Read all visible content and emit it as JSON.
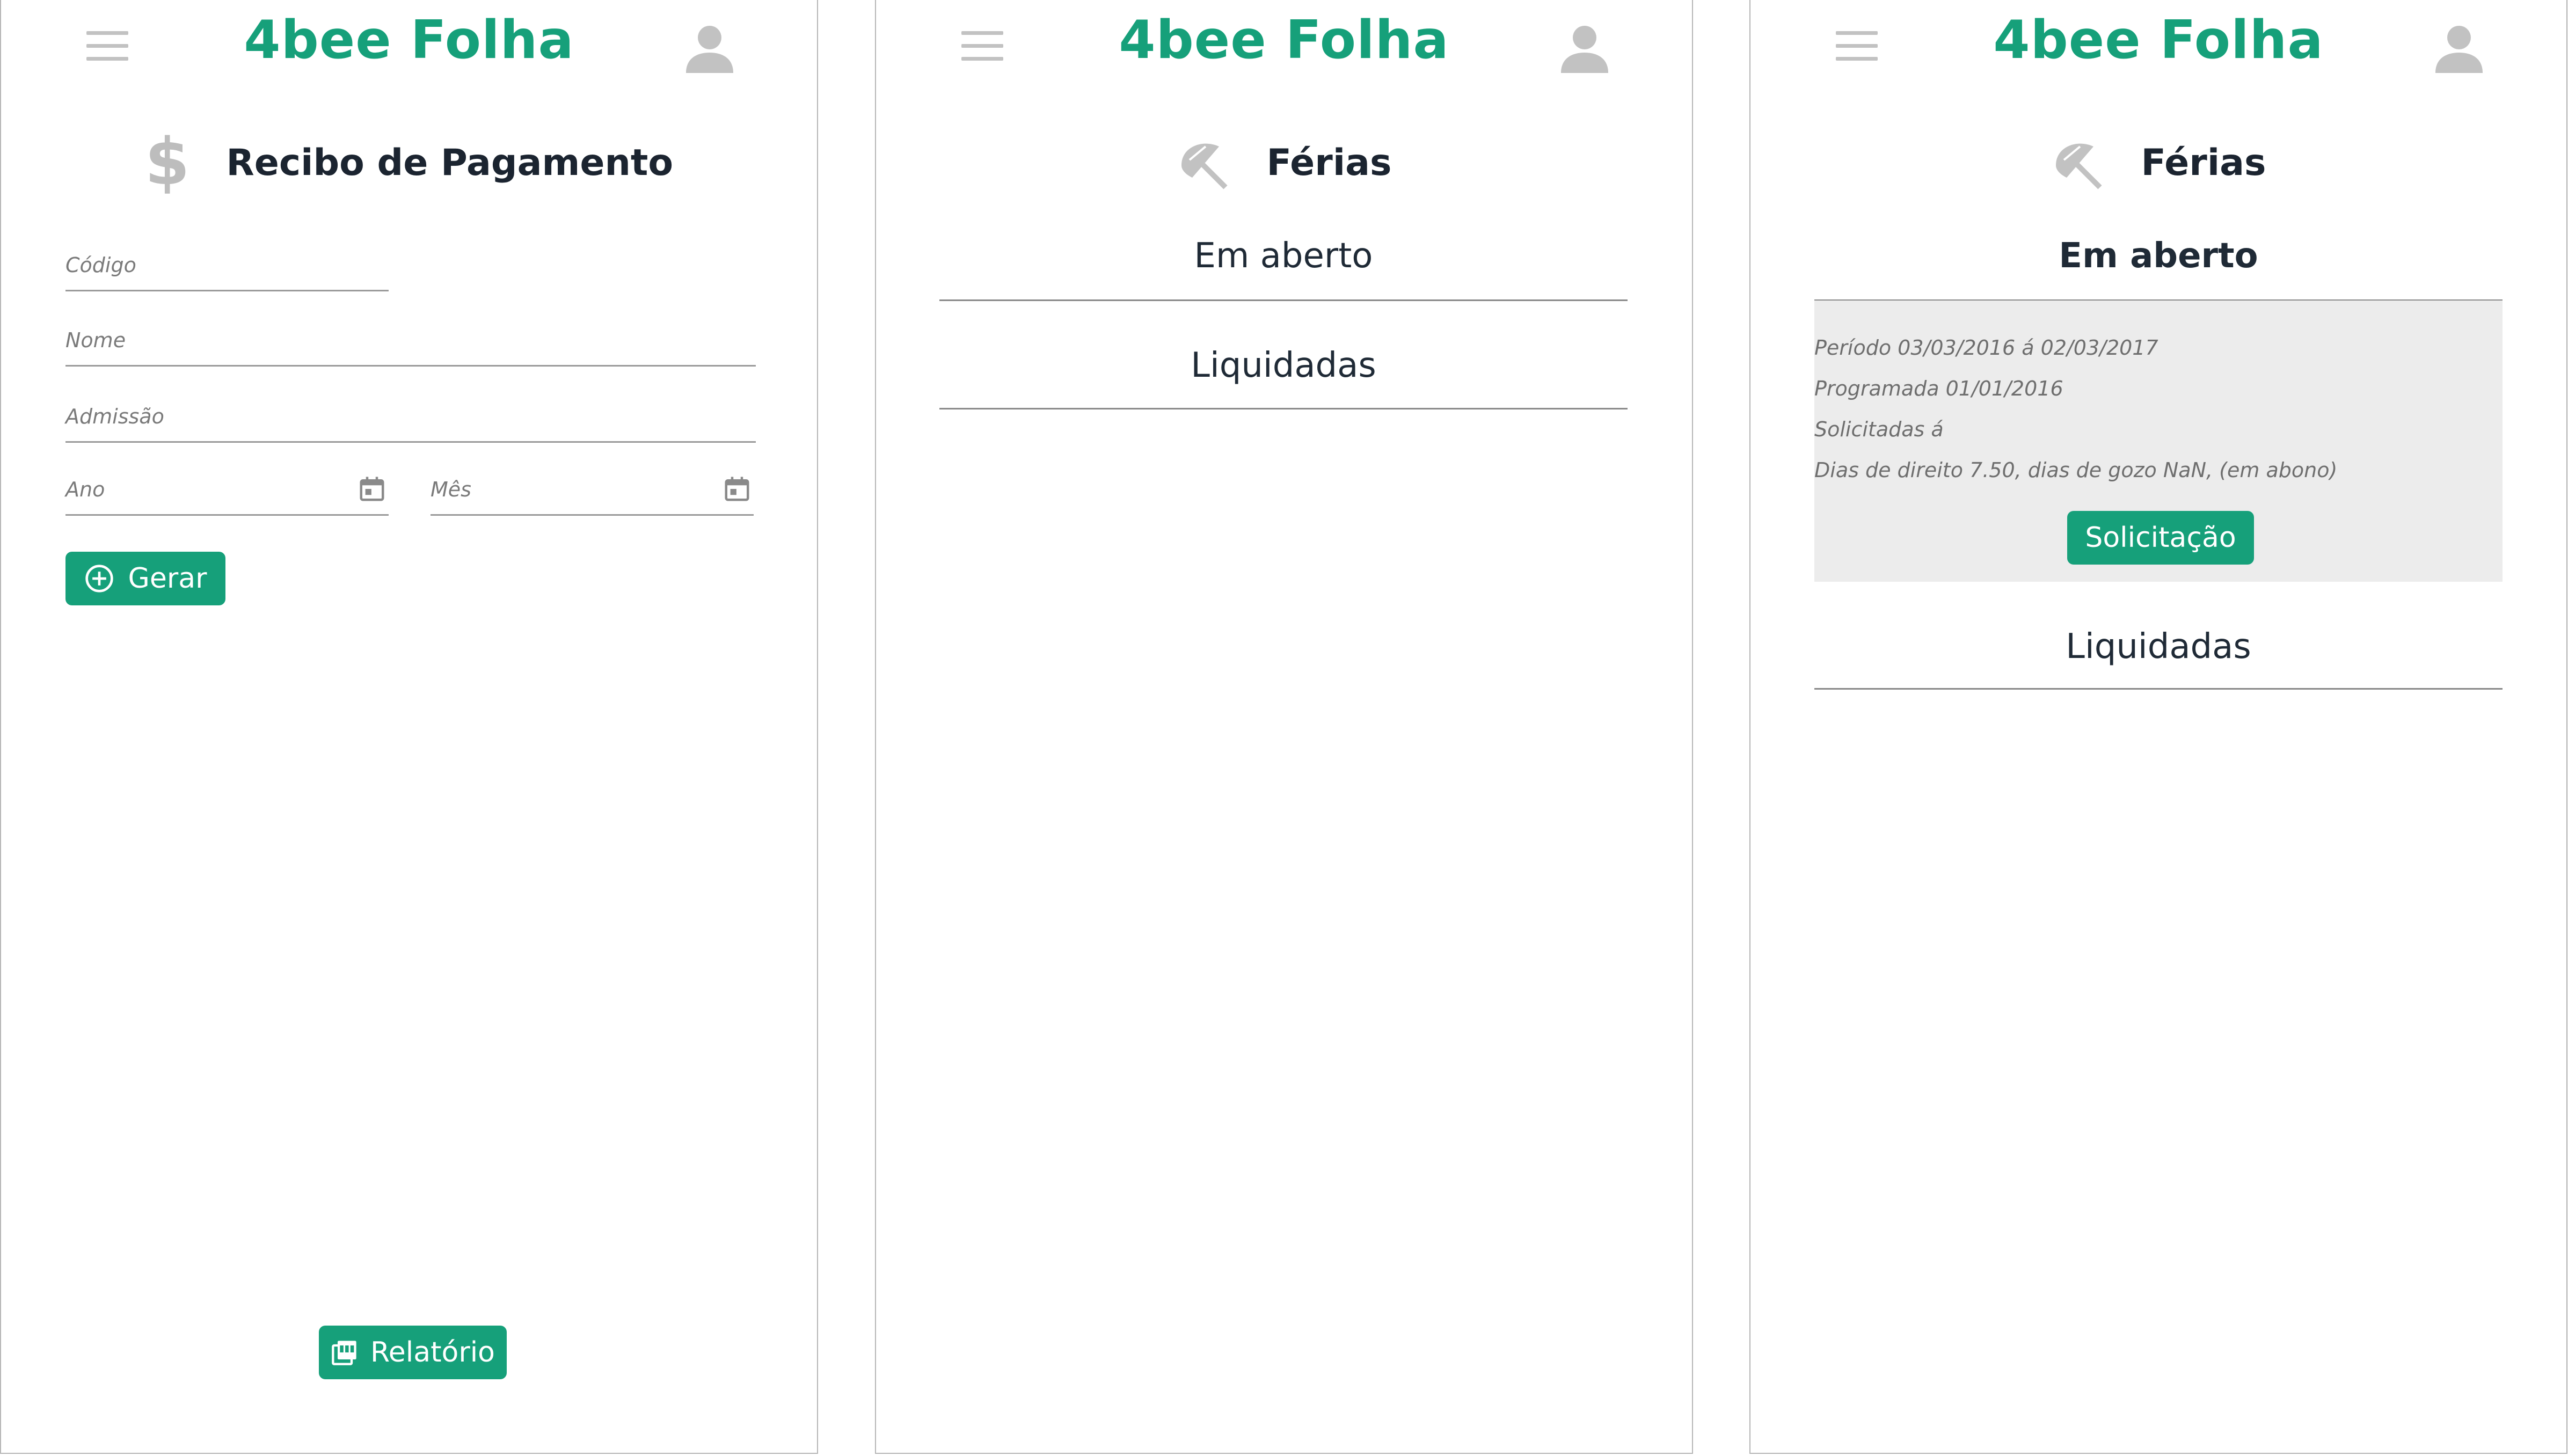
{
  "app": {
    "brand": "4bee Folha"
  },
  "screen1": {
    "title": "Recibo de Pagamento",
    "icon": "dollar-icon",
    "fields": {
      "codigo": "Código",
      "nome": "Nome",
      "admissao": "Admissão",
      "ano": "Ano",
      "mes": "Mês"
    },
    "gerar_label": "Gerar",
    "relatorio_label": "Relatório"
  },
  "screen2": {
    "title": "Férias",
    "icon": "beach-umbrella-icon",
    "sections": [
      "Em aberto",
      "Liquidadas"
    ]
  },
  "screen3": {
    "title": "Férias",
    "icon": "beach-umbrella-icon",
    "open_section": "Em aberto",
    "details": {
      "periodo": "Período 03/03/2016 á 02/03/2017",
      "programada": "Programada 01/01/2016",
      "solicitadas": "Solicitadas á",
      "dias": "Dias de direito 7.50, dias de gozo NaN, (em abono)"
    },
    "solicitacao_label": "Solicitação",
    "paid_section": "Liquidadas"
  },
  "colors": {
    "accent": "#16a07a",
    "icon_gray": "#c2c2c2",
    "panel_bg": "#ececec"
  }
}
